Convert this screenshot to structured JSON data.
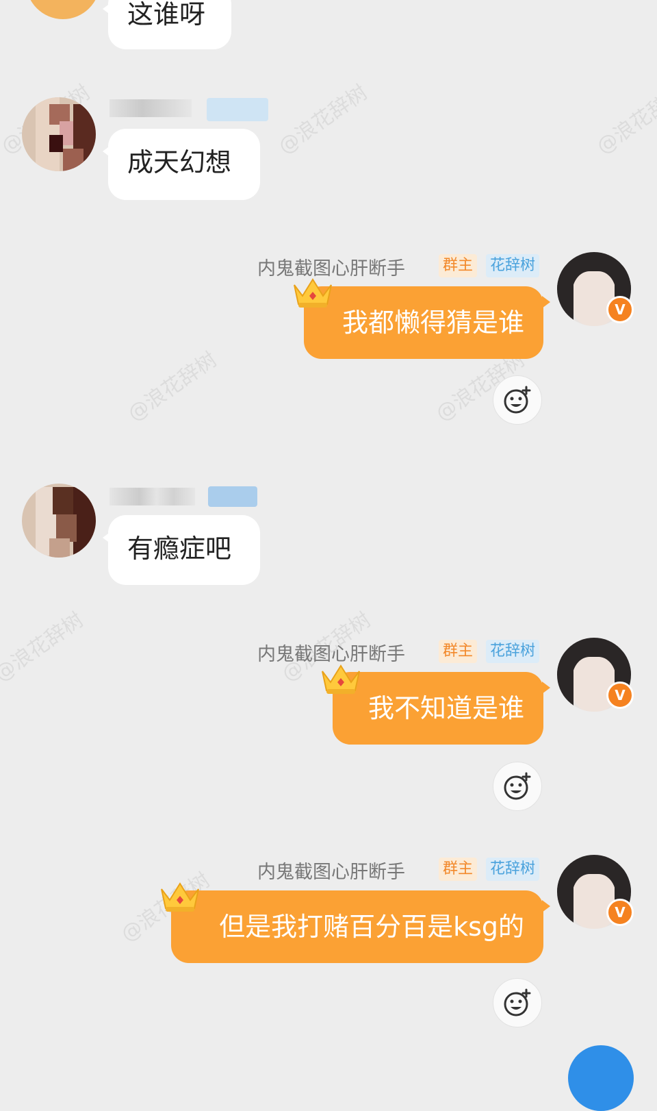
{
  "messages": [
    {
      "side": "in",
      "text": "这谁呀"
    },
    {
      "side": "in",
      "text": "成天幻想"
    },
    {
      "side": "out",
      "sender": "内鬼截图心肝断手",
      "role": "群主",
      "title": "花辞树",
      "text": "我都懒得猜是谁"
    },
    {
      "side": "in",
      "text": "有瘾症吧"
    },
    {
      "side": "out",
      "sender": "内鬼截图心肝断手",
      "role": "群主",
      "title": "花辞树",
      "text": "我不知道是谁"
    },
    {
      "side": "out",
      "sender": "内鬼截图心肝断手",
      "role": "群主",
      "title": "花辞树",
      "text": "但是我打赌百分百是ksg的"
    }
  ],
  "verified_badge": "V",
  "watermark": "@浪花辞树",
  "icons": {
    "reaction": "add-reaction-icon",
    "crown": "crown-icon",
    "verified": "verified-badge-icon"
  },
  "colors": {
    "background": "#ededed",
    "out_bubble": "#fba134",
    "in_bubble": "#ffffff",
    "owner_tag": "#f2892b",
    "title_tag": "#4aa2dc",
    "fab": "#2f8fe8"
  }
}
